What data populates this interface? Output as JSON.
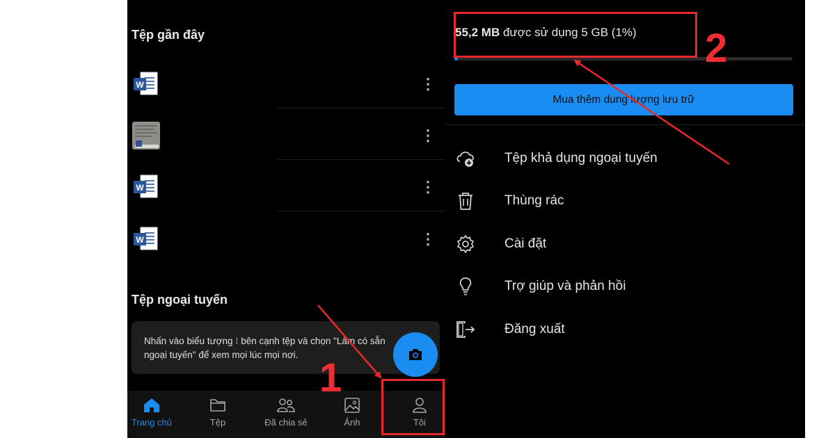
{
  "left": {
    "recent_title": "Tệp gần đây",
    "files": [
      {
        "icon": "word-doc-icon"
      },
      {
        "icon": "doc-thumbnail-icon"
      },
      {
        "icon": "word-doc-icon"
      },
      {
        "icon": "word-doc-icon"
      }
    ],
    "more_glyph": "⋮",
    "offline_title": "Tệp ngoại tuyến",
    "offline_hint_line1": "Nhấn vào biểu tượng  ⁝  bên cạnh tệp và chọn \"Làm có sẵn",
    "offline_hint_line2": "ngoại tuyến\" để xem mọi lúc mọi nơi.",
    "fab_icon": "camera-icon",
    "nav": [
      {
        "label": "Trang chủ",
        "icon": "home-icon",
        "active": true
      },
      {
        "label": "Tệp",
        "icon": "folder-icon",
        "active": false
      },
      {
        "label": "Đã chia sẻ",
        "icon": "shared-people-icon",
        "active": false
      },
      {
        "label": "Ảnh",
        "icon": "photo-icon",
        "active": false
      },
      {
        "label": "Tôi",
        "icon": "person-icon",
        "active": false
      }
    ]
  },
  "right": {
    "storage": {
      "used": "55,2 MB",
      "rest": " được sử dụng 5 GB (1%)",
      "percent": 1
    },
    "buy_button": "Mua thêm dung lượng lưu trữ",
    "menu": [
      {
        "label": "Tệp khả dụng ngoại tuyến",
        "icon": "cloud-download-icon"
      },
      {
        "label": "Thùng rác",
        "icon": "trash-icon"
      },
      {
        "label": "Cài đặt",
        "icon": "gear-icon"
      },
      {
        "label": "Trợ giúp và phản hồi",
        "icon": "lightbulb-icon"
      },
      {
        "label": "Đăng xuất",
        "icon": "sign-out-icon"
      }
    ]
  },
  "annotations": {
    "step1": "1",
    "step2": "2",
    "color": "#e8282d"
  },
  "colors": {
    "accent": "#1a8cf2",
    "background": "#000000",
    "word_blue": "#2b579a"
  }
}
